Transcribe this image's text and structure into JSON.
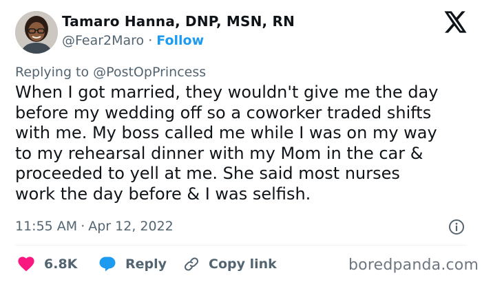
{
  "author": {
    "name": "Tamaro Hanna, DNP, MSN, RN",
    "handle": "@Fear2Maro",
    "separator": "·",
    "follow_label": "Follow"
  },
  "reply": {
    "prefix": "Replying to",
    "mention": "@PostOpPrincess"
  },
  "tweet_lines": [
    "When I got married, they wouldn't give me the day",
    "before my wedding off so a coworker traded shifts",
    "with me. My boss called me while I was on my way",
    "to my rehearsal dinner with my Mom in the car &",
    "proceeded to yell at me. She said most nurses",
    "work the day before & I was selfish."
  ],
  "meta": {
    "time": "11:55 AM",
    "separator": "·",
    "date": "Apr 12, 2022"
  },
  "actions": {
    "likes_count": "6.8K",
    "reply_label": "Reply",
    "copy_link_label": "Copy link"
  },
  "watermark": "boredpanda.com",
  "icons": {
    "logo": "x-logo-icon",
    "info": "info-icon",
    "like": "heart-icon",
    "reply": "speech-bubble-icon",
    "copy_link": "link-icon"
  },
  "colors": {
    "text": "#0f1419",
    "secondary": "#536471",
    "link": "#1d9bf0",
    "heart": "#f91880",
    "divider": "#eff3f4"
  }
}
